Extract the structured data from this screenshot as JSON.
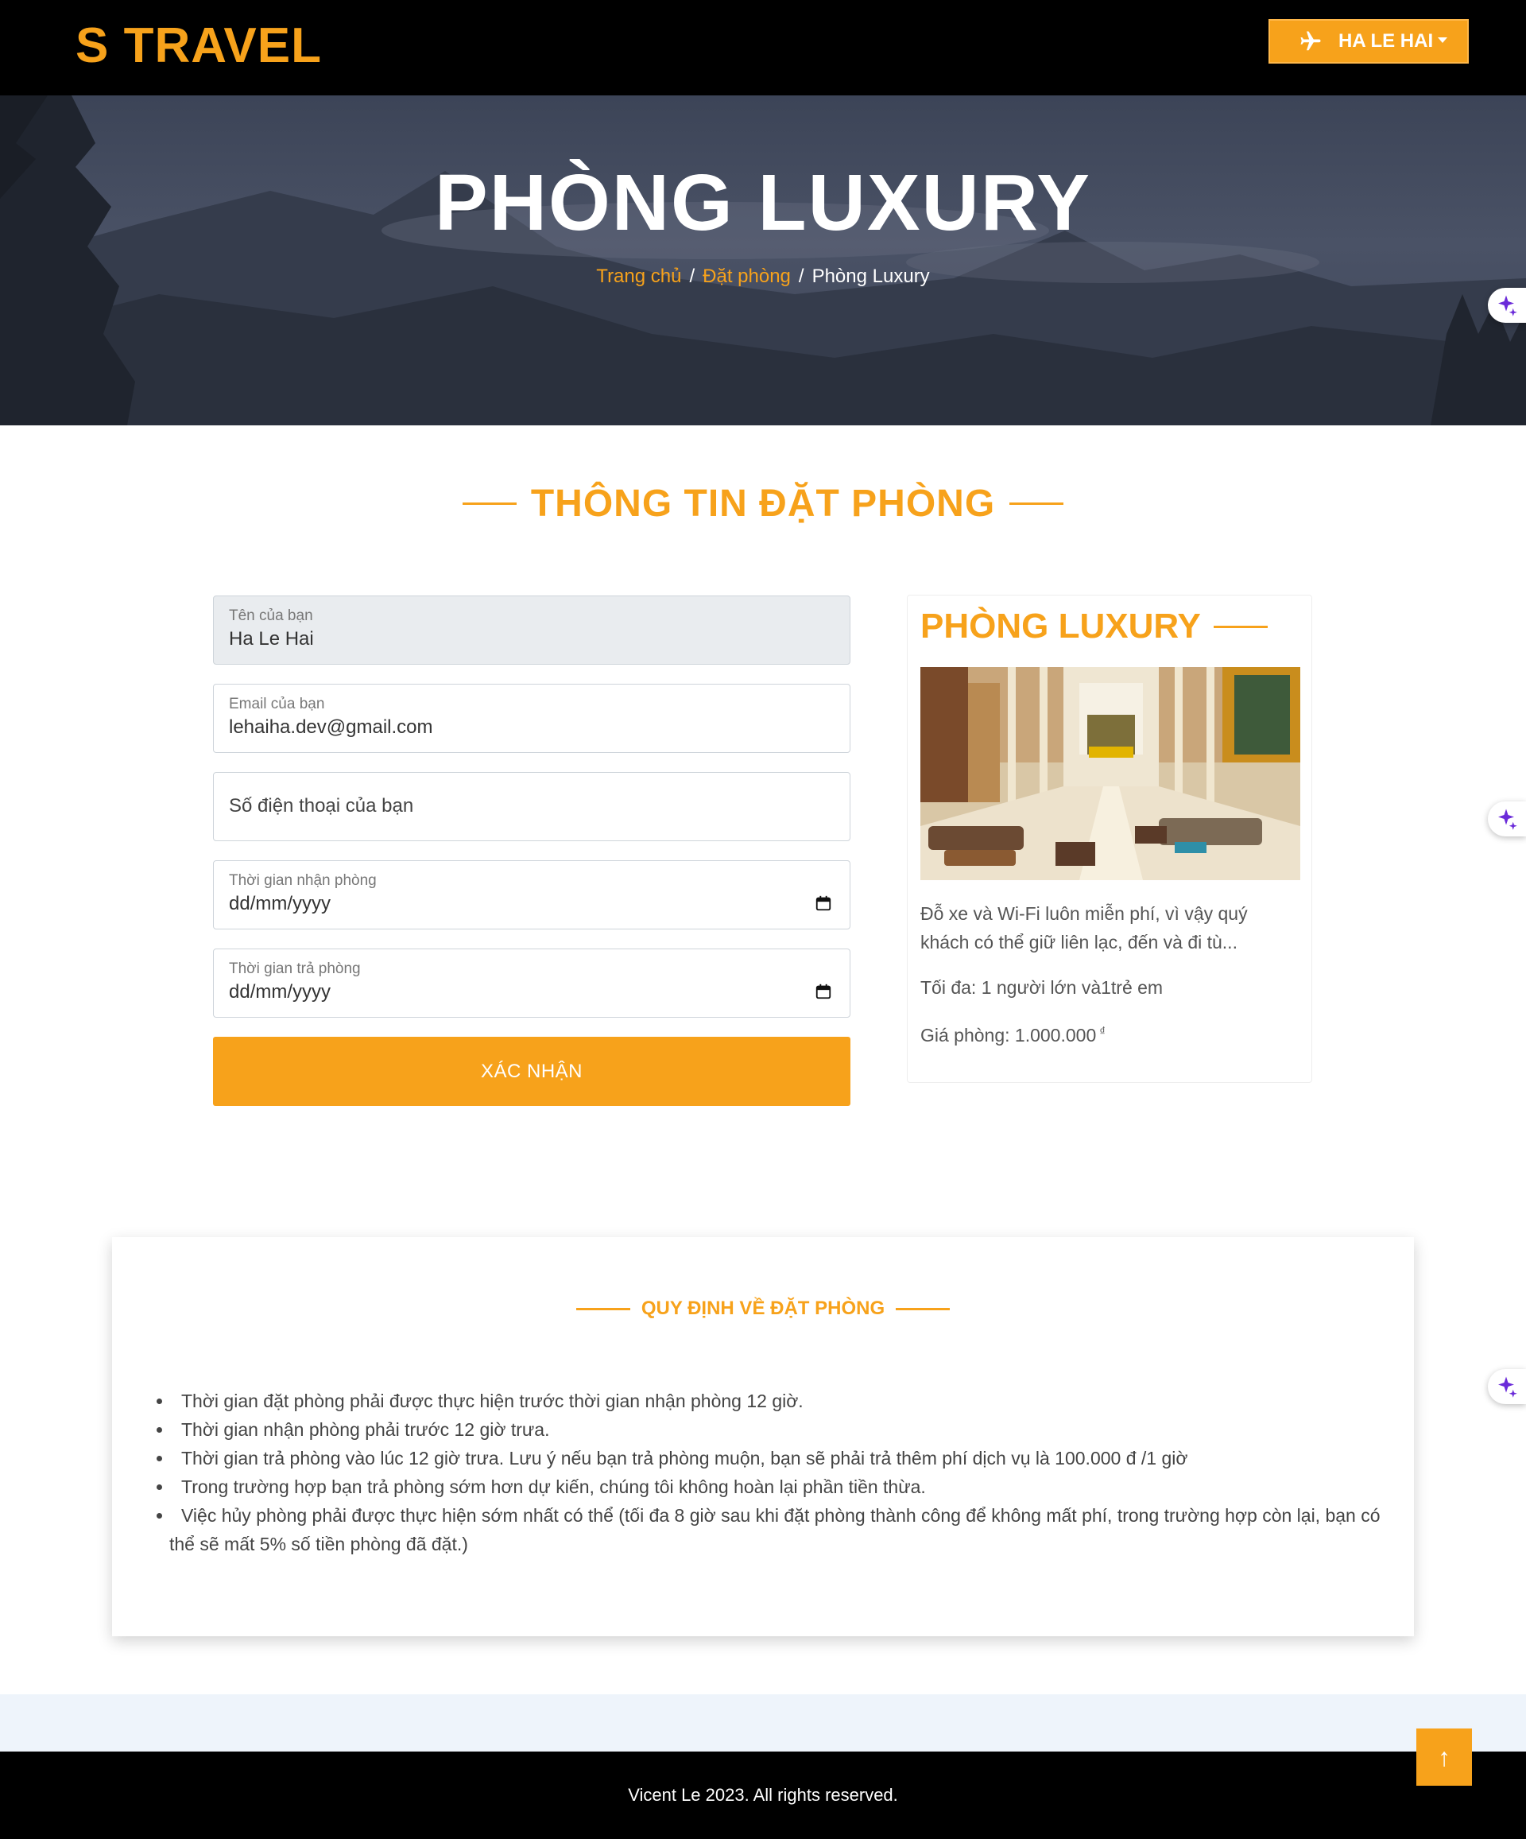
{
  "navbar": {
    "brand": "S TRAVEL",
    "user_name": "HA LE HAI",
    "user_icon": "plane-icon"
  },
  "hero": {
    "title": "PHÒNG LUXURY",
    "breadcrumb": {
      "home": "Trang chủ",
      "booking": "Đặt phòng",
      "current": "Phòng Luxury",
      "separator": "/"
    }
  },
  "booking": {
    "section_title": "THÔNG TIN ĐẶT PHÒNG",
    "fields": {
      "name": {
        "label": "Tên của bạn",
        "value": "Ha Le Hai"
      },
      "email": {
        "label": "Email của bạn",
        "value": "lehaiha.dev@gmail.com"
      },
      "phone": {
        "placeholder": "Số điện thoại của bạn"
      },
      "checkin": {
        "label": "Thời gian nhận phòng",
        "value": "dd/mm/yyyy"
      },
      "checkout": {
        "label": "Thời gian trả phòng",
        "value": "dd/mm/yyyy"
      }
    },
    "submit_label": "XÁC NHẬN"
  },
  "room": {
    "title": "PHÒNG LUXURY",
    "description": "Đỗ xe và Wi-Fi luôn miễn phí, vì vậy quý khách có thể giữ liên lạc, đến và đi tù...",
    "max_guests": "Tối đa: 1 người lớn và1trẻ em",
    "price": "Giá phòng: 1.000.000",
    "currency": "₫"
  },
  "rules": {
    "title": "QUY ĐỊNH VỀ ĐẶT PHÒNG",
    "items": [
      "Thời gian đặt phòng phải được thực hiện trước thời gian nhận phòng 12 giờ.",
      "Thời gian nhận phòng phải trước 12 giờ trưa.",
      "Thời gian trả phòng vào lúc 12 giờ trưa. Lưu ý nếu bạn trả phòng muộn, bạn sẽ phải trả thêm phí dịch vụ là 100.000 đ /1 giờ",
      "Trong trường hợp bạn trả phòng sớm hơn dự kiến, chúng tôi không hoàn lại phần tiền thừa.",
      "Việc hủy phòng phải được thực hiện sớm nhất có thể (tối đa 8 giờ sau khi đặt phòng thành công để không mất phí, trong trường hợp còn lại, bạn có thể sẽ mất 5% số tiền phòng đã đặt.)"
    ]
  },
  "footer": {
    "copyright": "Vicent Le 2023. All rights reserved."
  },
  "back_to_top": "↑",
  "colors": {
    "accent": "#f7a21b",
    "navbar": "#000000",
    "sparkle": "#6b2bd9"
  }
}
